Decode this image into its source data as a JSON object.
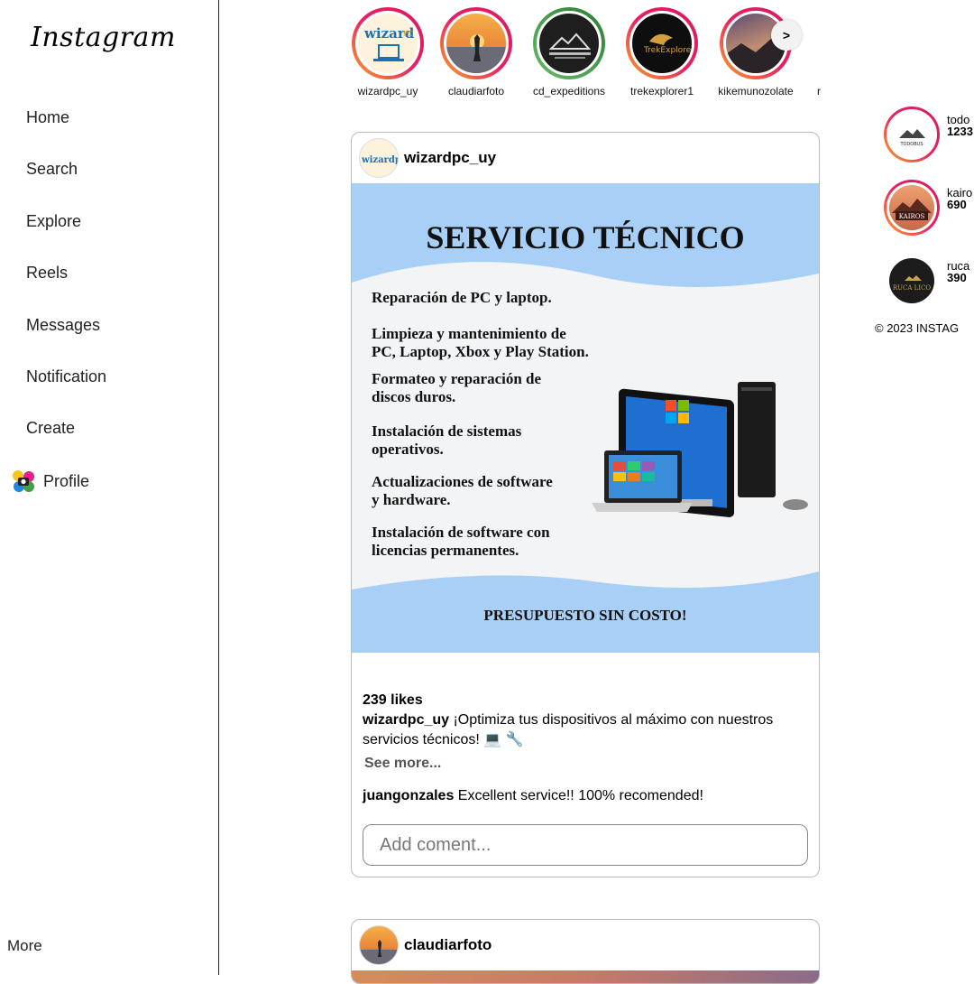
{
  "sidebar": {
    "logo": "Instagram",
    "items": [
      {
        "label": "Home"
      },
      {
        "label": "Search"
      },
      {
        "label": "Explore"
      },
      {
        "label": "Reels"
      },
      {
        "label": "Messages"
      },
      {
        "label": "Notification"
      },
      {
        "label": "Create"
      }
    ],
    "profile_label": "Profile",
    "more_label": "More"
  },
  "stories": {
    "items": [
      {
        "name": "wizardpc_uy"
      },
      {
        "name": "claudiarfoto"
      },
      {
        "name": "cd_expeditions"
      },
      {
        "name": "trekexplorer1"
      },
      {
        "name": "kikemunozolate"
      },
      {
        "name": "r"
      }
    ],
    "next_label": ">"
  },
  "post1": {
    "user": "wizardpc_uy",
    "avatar_text": "wizardpc",
    "flyer": {
      "title": "SERVICIO TÉCNICO",
      "lines": [
        "Reparación de PC y laptop.",
        "Limpieza y mantenimiento de PC, Laptop, Xbox y Play Station.",
        "Formateo y reparación de discos duros.",
        "Instalación de sistemas operativos.",
        "Actualizaciones de software y hardware.",
        "Instalación de software con licencias permanentes."
      ],
      "footer": "PRESUPUESTO SIN COSTO!"
    },
    "likes": "239 likes",
    "caption_user": "wizardpc_uy",
    "caption_text": " ¡Optimiza tus dispositivos al máximo con nuestros servicios técnicos! 💻 🔧",
    "see_more": "See more...",
    "comment_user": "juangonzales",
    "comment_text": " Excellent service!! 100% recomended!",
    "comment_placeholder": "Add coment..."
  },
  "post2": {
    "user": "claudiarfoto"
  },
  "suggestions": [
    {
      "name": "todo",
      "count": "1233",
      "logo_text": "TODOBUS"
    },
    {
      "name": "kairo",
      "count": "690",
      "logo_text": "KAIROS"
    },
    {
      "name": "ruca",
      "count": "390",
      "logo_text": "RUCA LICO"
    }
  ],
  "copyright": "© 2023 INSTAG"
}
